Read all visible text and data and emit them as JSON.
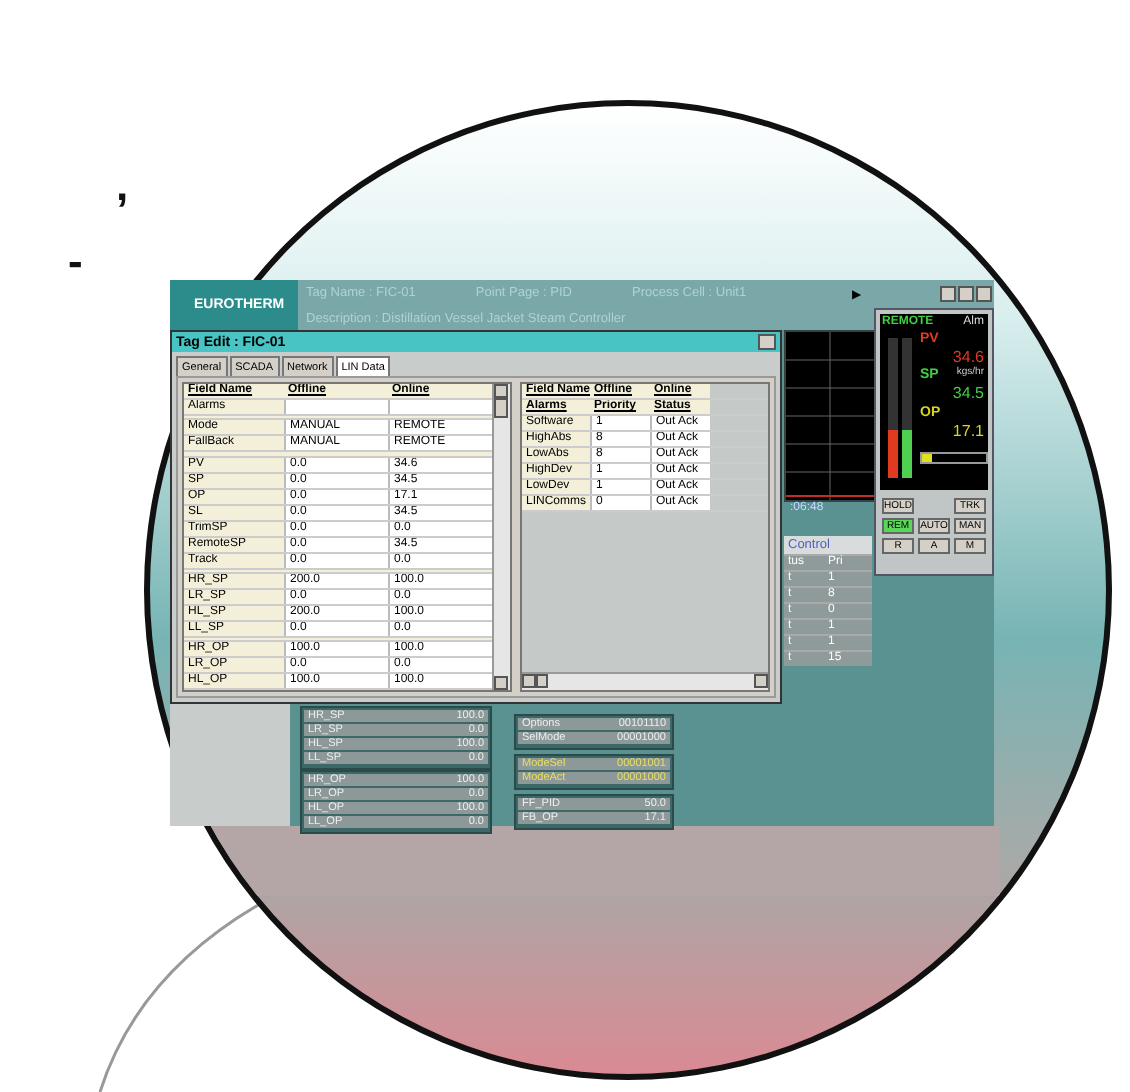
{
  "margin_marks": [
    ",",
    "-"
  ],
  "header": {
    "logo": "EUROTHERM",
    "tag_name": "Tag Name : FIC-01",
    "point_page": "Point Page : PID",
    "process_cell": "Process Cell : Unit1",
    "next_arrow": "▶",
    "description": "Description : Distillation Vessel Jacket Steam Controller"
  },
  "trend": {
    "time": ":06:48"
  },
  "control_panel": {
    "title": "Control",
    "columns": [
      "tus",
      "Pri"
    ],
    "rows": [
      {
        "status": "t",
        "priority": "1"
      },
      {
        "status": "t",
        "priority": "8"
      },
      {
        "status": "t",
        "priority": "0"
      },
      {
        "status": "t",
        "priority": "1"
      },
      {
        "status": "t",
        "priority": "1"
      },
      {
        "status": "t",
        "priority": "15"
      }
    ]
  },
  "faceplate": {
    "mode": "REMOTE",
    "alarm": "Alm",
    "pv_label": "PV",
    "pv": "34.6",
    "units": "kgs/hr",
    "sp_label": "SP",
    "sp": "34.5",
    "op_label": "OP",
    "op": "17.1",
    "pv_bar": {
      "level": 0.35
    },
    "sp_bar": {
      "level": 0.35
    },
    "op_bar": {
      "level": 0.15
    },
    "buttons": [
      {
        "label": "HOLD",
        "selected": false
      },
      {
        "label": "TRK",
        "selected": false
      },
      {
        "label": "REM",
        "selected": true
      },
      {
        "label": "AUTO",
        "selected": false
      },
      {
        "label": "MAN",
        "selected": false
      },
      {
        "label": "R",
        "selected": false
      },
      {
        "label": "A",
        "selected": false
      },
      {
        "label": "M",
        "selected": false
      }
    ]
  },
  "lower_panels": [
    {
      "rows": [
        {
          "name": "HR_SP",
          "value": "100.0",
          "highlighted": false
        },
        {
          "name": "LR_SP",
          "value": "0.0",
          "highlighted": false
        },
        {
          "name": "HL_SP",
          "value": "100.0",
          "highlighted": false
        },
        {
          "name": "LL_SP",
          "value": "0.0",
          "highlighted": false
        }
      ]
    },
    {
      "rows": [
        {
          "name": "HR_OP",
          "value": "100.0",
          "highlighted": false
        },
        {
          "name": "LR_OP",
          "value": "0.0",
          "highlighted": false
        },
        {
          "name": "HL_OP",
          "value": "100.0",
          "highlighted": false
        },
        {
          "name": "LL_OP",
          "value": "0.0",
          "highlighted": false
        }
      ]
    },
    {
      "rows": [
        {
          "name": "Options",
          "value": "00101110",
          "highlighted": false
        },
        {
          "name": "SelMode",
          "value": "00001000",
          "highlighted": false
        }
      ]
    },
    {
      "rows": [
        {
          "name": "ModeSel",
          "value": "00001001",
          "highlighted": true
        },
        {
          "name": "ModeAct",
          "value": "00001000",
          "highlighted": true
        }
      ]
    },
    {
      "rows": [
        {
          "name": "FF_PID",
          "value": "50.0",
          "highlighted": false
        },
        {
          "name": "FB_OP",
          "value": "17.1",
          "highlighted": false
        }
      ]
    }
  ],
  "dialog": {
    "title": "Tag Edit : FIC-01",
    "tabs": [
      {
        "label": "General",
        "selected": false
      },
      {
        "label": "SCADA",
        "selected": false
      },
      {
        "label": "Network",
        "selected": false
      },
      {
        "label": "LIN Data",
        "selected": true
      }
    ],
    "left_table": {
      "columns": [
        "Field Name",
        "Offline",
        "Online"
      ],
      "rows": [
        {
          "kind": "group",
          "name": "Alarms"
        },
        {
          "kind": "spacer"
        },
        {
          "kind": "value",
          "name": "Mode",
          "offline": "MANUAL",
          "online": "REMOTE"
        },
        {
          "kind": "value",
          "name": "FallBack",
          "offline": "MANUAL",
          "online": "REMOTE"
        },
        {
          "kind": "spacer"
        },
        {
          "kind": "value",
          "name": "PV",
          "offline": "0.0",
          "online": "34.6"
        },
        {
          "kind": "value",
          "name": "SP",
          "offline": "0.0",
          "online": "34.5"
        },
        {
          "kind": "value",
          "name": "OP",
          "offline": "0.0",
          "online": "17.1"
        },
        {
          "kind": "value",
          "name": "SL",
          "offline": "0.0",
          "online": "34.5"
        },
        {
          "kind": "value",
          "name": "TrimSP",
          "offline": "0.0",
          "online": "0.0"
        },
        {
          "kind": "value",
          "name": "RemoteSP",
          "offline": "0.0",
          "online": "34.5"
        },
        {
          "kind": "value",
          "name": "Track",
          "offline": "0.0",
          "online": "0.0"
        },
        {
          "kind": "spacer"
        },
        {
          "kind": "value",
          "name": "HR_SP",
          "offline": "200.0",
          "online": "100.0"
        },
        {
          "kind": "value",
          "name": "LR_SP",
          "offline": "0.0",
          "online": "0.0"
        },
        {
          "kind": "value",
          "name": "HL_SP",
          "offline": "200.0",
          "online": "100.0"
        },
        {
          "kind": "value",
          "name": "LL_SP",
          "offline": "0.0",
          "online": "0.0"
        },
        {
          "kind": "spacer"
        },
        {
          "kind": "value",
          "name": "HR_OP",
          "offline": "100.0",
          "online": "100.0"
        },
        {
          "kind": "value",
          "name": "LR_OP",
          "offline": "0.0",
          "online": "0.0"
        },
        {
          "kind": "value",
          "name": "HL_OP",
          "offline": "100.0",
          "online": "100.0"
        }
      ]
    },
    "right_table": {
      "columns": [
        "Field Name",
        "Offline",
        "Online"
      ],
      "subheader": [
        "Alarms",
        "Priority",
        "Status"
      ],
      "rows": [
        {
          "name": "Software",
          "priority": "1",
          "status": "Out Ack"
        },
        {
          "name": "HighAbs",
          "priority": "8",
          "status": "Out Ack"
        },
        {
          "name": "LowAbs",
          "priority": "8",
          "status": "Out Ack"
        },
        {
          "name": "HighDev",
          "priority": "1",
          "status": "Out Ack"
        },
        {
          "name": "LowDev",
          "priority": "1",
          "status": "Out Ack"
        },
        {
          "name": "LINComms",
          "priority": "0",
          "status": "Out Ack"
        }
      ]
    }
  }
}
